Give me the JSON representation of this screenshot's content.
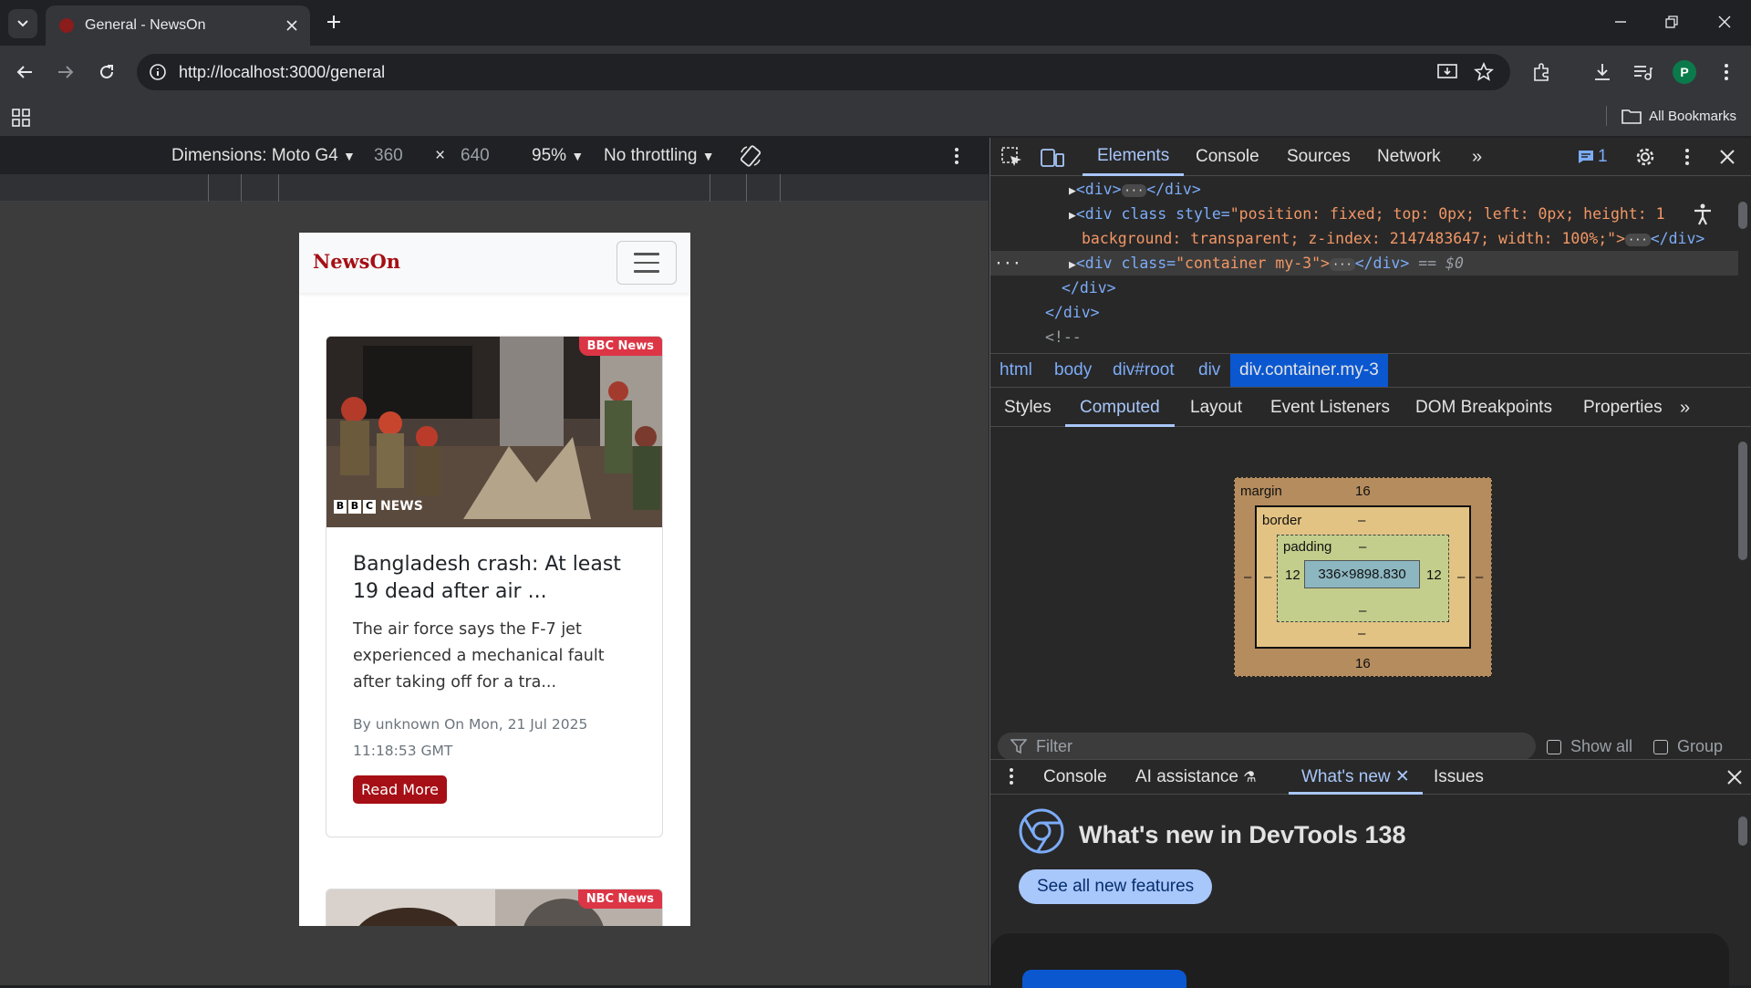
{
  "browser": {
    "tab_title": "General - NewsOn",
    "url": "http://localhost:3000/general",
    "avatar_letter": "P",
    "all_bookmarks": "All Bookmarks"
  },
  "device_toolbar": {
    "dimensions_label": "Dimensions: Moto G4",
    "width": "360",
    "times": "×",
    "height": "640",
    "zoom": "95%",
    "throttling": "No throttling"
  },
  "page": {
    "brand": "NewsOn",
    "cards": [
      {
        "source": "BBC News",
        "image_overlay": "NEWS",
        "title": "Bangladesh crash: At least 19 dead after air ...",
        "description": "The air force says the F-7 jet experienced a mechanical fault after taking off for a tra...",
        "meta": "By unknown On Mon, 21 Jul 2025 11:18:53 GMT",
        "button": "Read More"
      },
      {
        "source": "NBC News"
      }
    ]
  },
  "devtools": {
    "tabs": [
      "Elements",
      "Console",
      "Sources",
      "Network"
    ],
    "issues_count": "1",
    "dom_lines": {
      "l1_tag": "<div>",
      "l1_close": "</div>",
      "l2_open": "<div class style=",
      "l2_value": "\"position: fixed; top: 0px; left: 0px; height: 1",
      "l2b_value": "background: transparent; z-index: 2147483647; width: 100%;\">",
      "l2b_close": "</div>",
      "l3_open": "<div class=",
      "l3_value": "\"container my-3\">",
      "l3_close": "</div>",
      "l3_eq": "== $0",
      "l4": "</div>",
      "l5": "</div>",
      "l6": "<!--"
    },
    "breadcrumbs": [
      "html",
      "body",
      "div#root",
      "div",
      "div.container.my-3"
    ],
    "subtabs": [
      "Styles",
      "Computed",
      "Layout",
      "Event Listeners",
      "DOM Breakpoints",
      "Properties"
    ],
    "box_model": {
      "margin_label": "margin",
      "margin_top": "16",
      "margin_bottom": "16",
      "margin_side": "–",
      "border_label": "border",
      "border_value": "–",
      "padding_label": "padding",
      "padding_top": "–",
      "padding_bottom": "–",
      "padding_left": "12",
      "padding_right": "12",
      "content": "336×9898.830"
    },
    "filter_placeholder": "Filter",
    "show_all": "Show all",
    "group": "Group",
    "drawer_tabs": [
      "Console",
      "AI assistance",
      "What's new",
      "Issues"
    ],
    "whats_new_title": "What's new in DevTools 138",
    "see_all_button": "See all new features"
  },
  "colors": {
    "brand_red": "#a50f15",
    "badge_red": "#dc3545",
    "accent_blue": "#a8c7fa"
  }
}
